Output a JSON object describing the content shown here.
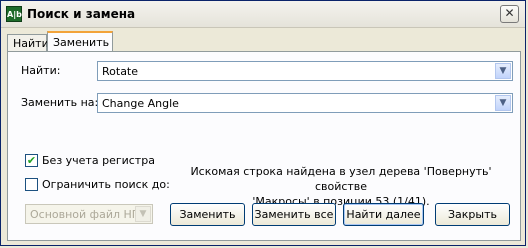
{
  "window": {
    "title": "Поиск и замена",
    "icon_text": "A|b",
    "close_glyph": "✕"
  },
  "tabs": [
    {
      "label": "Найти",
      "active": false
    },
    {
      "label": "Заменить",
      "active": true
    }
  ],
  "form": {
    "find_label": "Найти:",
    "find_value": "Rotate",
    "replace_label": "Заменить на:",
    "replace_value": "Change Angle",
    "case_label": "Без учета регистра",
    "case_checked": true,
    "limit_label": "Ограничить поиск до:",
    "limit_checked": false,
    "limit_select_value": "Основной файл НП"
  },
  "status": {
    "line1": "Искомая строка найдена в узел дерева 'Повернуть' свойстве",
    "line2": "'Макросы' в позиции 53 (1/41)."
  },
  "buttons": {
    "replace": "Заменить",
    "replace_all": "Заменить все",
    "find_next": "Найти далее",
    "close": "Закрыть"
  },
  "icons": {
    "dropdown": "chevron-down-icon",
    "check": "checkmark-icon"
  },
  "colors": {
    "titlebar_border": "#0a246a",
    "accent_tab": "#f2a33a",
    "check_green": "#21a121"
  }
}
